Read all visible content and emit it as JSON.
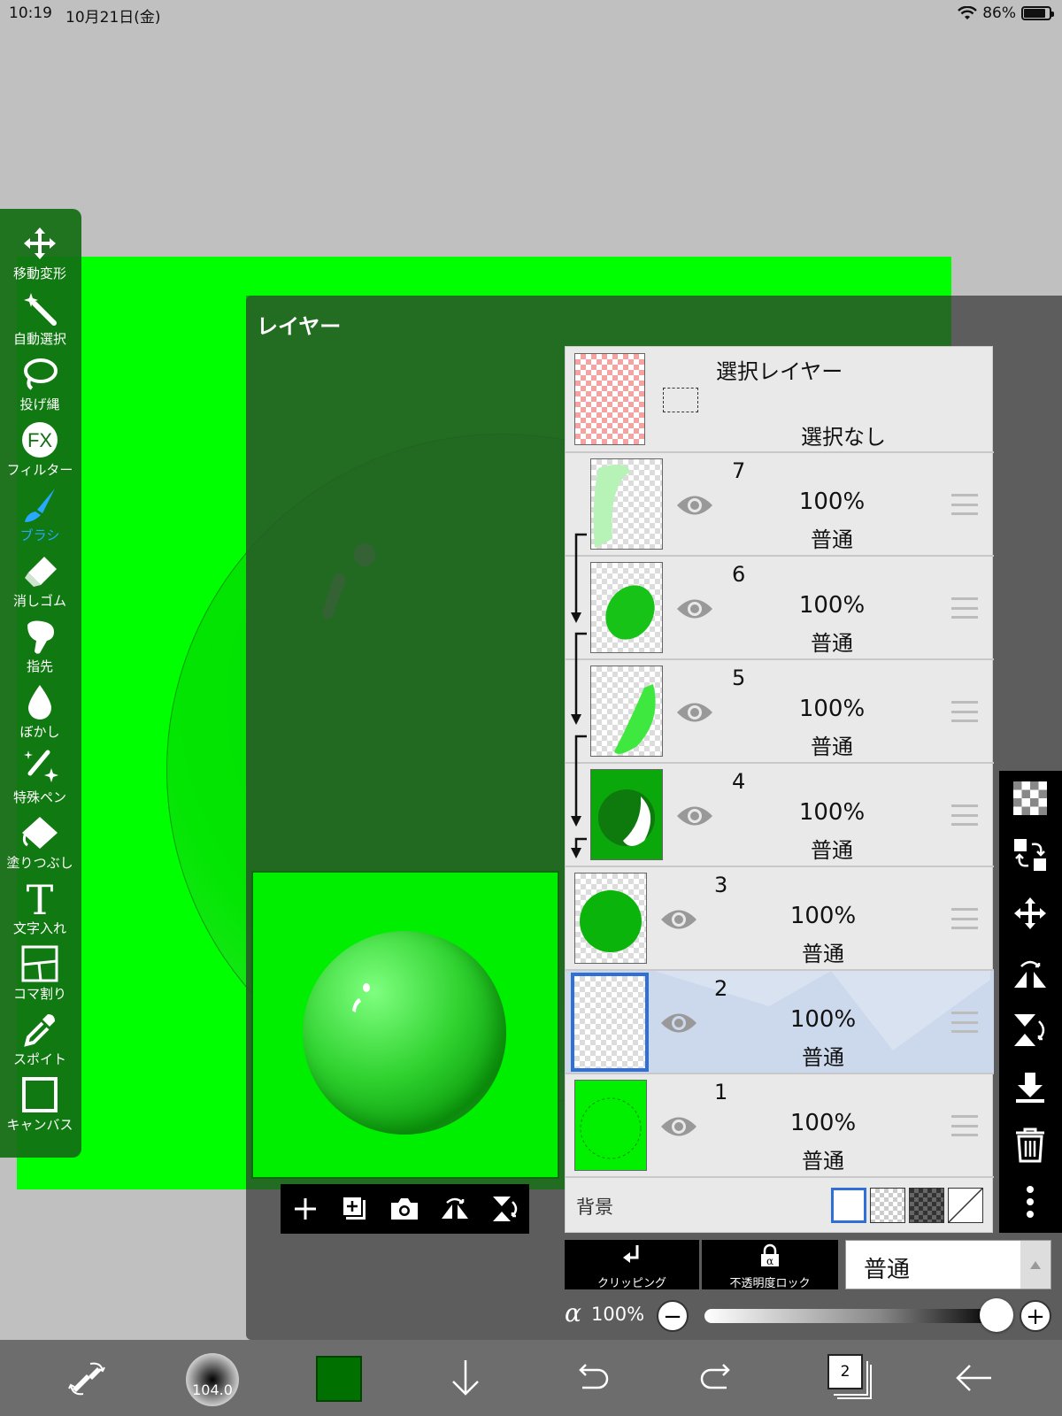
{
  "status_bar": {
    "time": "10:19",
    "date": "10月21日(金)",
    "battery": "86%",
    "battery_level": 0.86
  },
  "toolbar": {
    "tools": [
      {
        "label": "移動変形",
        "icon": "move-transform-icon"
      },
      {
        "label": "自動選択",
        "icon": "magic-wand-icon"
      },
      {
        "label": "投げ縄",
        "icon": "lasso-icon"
      },
      {
        "label": "フィルター",
        "icon": "fx-filter-icon"
      },
      {
        "label": "ブラシ",
        "icon": "brush-icon",
        "active": true
      },
      {
        "label": "消しゴム",
        "icon": "eraser-icon"
      },
      {
        "label": "指先",
        "icon": "finger-smudge-icon"
      },
      {
        "label": "ぼかし",
        "icon": "blur-drop-icon"
      },
      {
        "label": "特殊ペン",
        "icon": "special-pen-icon"
      },
      {
        "label": "塗りつぶし",
        "icon": "fill-bucket-icon"
      },
      {
        "label": "文字入れ",
        "icon": "text-icon"
      },
      {
        "label": "コマ割り",
        "icon": "frame-divider-icon"
      },
      {
        "label": "スポイト",
        "icon": "eyedropper-icon"
      },
      {
        "label": "キャンバス",
        "icon": "canvas-icon"
      }
    ]
  },
  "layer_panel": {
    "title": "レイヤー",
    "selection_layer": {
      "title": "選択レイヤー",
      "status": "選択なし"
    },
    "layers": [
      {
        "number": "7",
        "opacity": "100%",
        "mode": "普通",
        "clipped": true
      },
      {
        "number": "6",
        "opacity": "100%",
        "mode": "普通",
        "clipped": true
      },
      {
        "number": "5",
        "opacity": "100%",
        "mode": "普通",
        "clipped": true
      },
      {
        "number": "4",
        "opacity": "100%",
        "mode": "普通",
        "clipped": true
      },
      {
        "number": "3",
        "opacity": "100%",
        "mode": "普通",
        "clipped": false
      },
      {
        "number": "2",
        "opacity": "100%",
        "mode": "普通",
        "clipped": false,
        "selected": true
      },
      {
        "number": "1",
        "opacity": "100%",
        "mode": "普通",
        "clipped": false
      }
    ],
    "background": {
      "label": "背景"
    },
    "clipping_label": "クリッピング",
    "alpha_lock_label": "不透明度ロック",
    "blend_mode": "普通",
    "opacity_symbol": "α",
    "opacity_value": "100%",
    "opacity_level": 1.0
  },
  "bottom_bar": {
    "brush_size": "104.0",
    "color": "#007000",
    "layer_count": "2"
  },
  "colors": {
    "canvas": "#00ff00",
    "toolbar": "#126e12",
    "accent": "#29a8ff",
    "selected_row": "#ccd8ec"
  }
}
